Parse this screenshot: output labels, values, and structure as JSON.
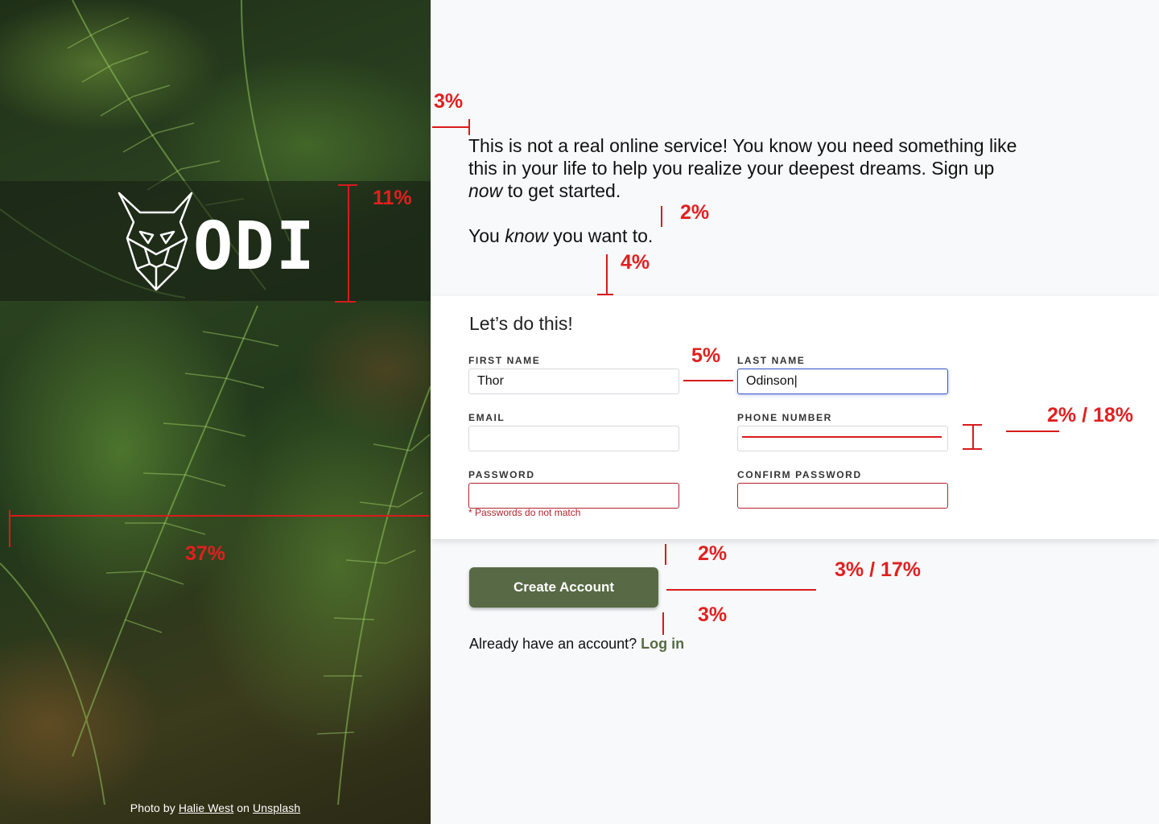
{
  "brand": {
    "logo_name": "ODIN",
    "logo_icon": "viking-dog-head"
  },
  "hero": {
    "credit_prefix": "Photo by",
    "credit_author": "Halie West",
    "credit_middle": "on",
    "credit_source": "Unsplash"
  },
  "intro": {
    "line1_a": "This is not a real online service! You know you need something like this in your life to help you realize your deepest dreams. Sign up ",
    "line1_em": "now",
    "line1_b": " to get started.",
    "line2_a": "You ",
    "line2_em": "know",
    "line2_b": " you want to."
  },
  "form": {
    "heading": "Let’s do this!",
    "first_name": {
      "label": "First Name",
      "value": "Thor"
    },
    "last_name": {
      "label": "Last Name",
      "value": "Odinson|"
    },
    "email": {
      "label": "Email",
      "value": ""
    },
    "phone": {
      "label": "Phone Number",
      "value": ""
    },
    "password": {
      "label": "Password",
      "value": ""
    },
    "confirm_password": {
      "label": "Confirm Password",
      "value": ""
    },
    "error": "* Passwords do not match"
  },
  "actions": {
    "create_label": "Create Account",
    "login_prompt": "Already have an account?",
    "login_link": "Log in"
  },
  "annotations": {
    "a_3pct_top": "3%",
    "a_11pct": "11%",
    "a_2pct_intro": "2%",
    "a_4pct": "4%",
    "a_5pct": "5%",
    "a_2_18pct": "2% / 18%",
    "a_37pct": "37%",
    "a_2pct_card": "2%",
    "a_3_17pct": "3% / 17%",
    "a_3pct_bottom": "3%"
  },
  "colors": {
    "accent": "#586a45",
    "error": "#b3242f",
    "focus": "#3a56c9",
    "annotation": "#e02020"
  }
}
